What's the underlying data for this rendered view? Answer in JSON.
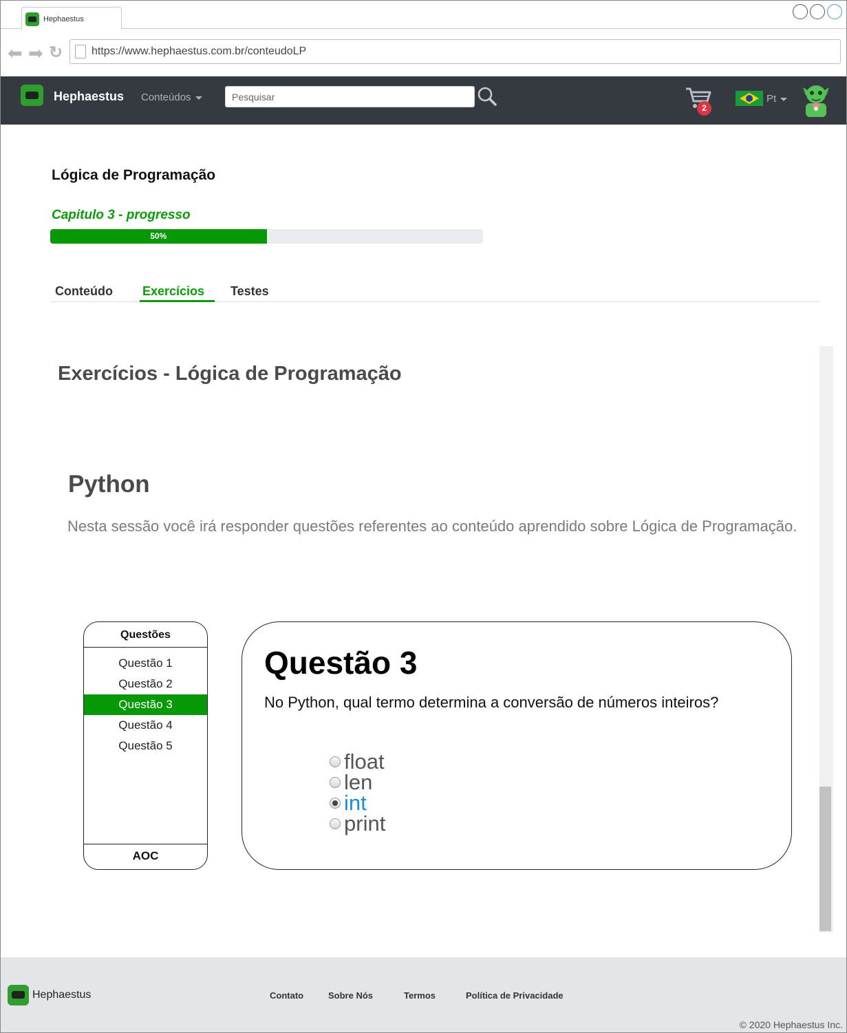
{
  "browser": {
    "tab_title": "Hephaestus",
    "url": "https://www.hephaestus.com.br/conteudoLP"
  },
  "navbar": {
    "brand": "Hephaestus",
    "menu_label": "Conteúdos",
    "search_placeholder": "Pesquisar",
    "cart_count": "2",
    "language": "Pt"
  },
  "course": {
    "title": "Lógica de Programação",
    "chapter_label": "Capitulo 3 - progresso",
    "progress_text": "50%",
    "progress_value": 0.5
  },
  "tabs": [
    {
      "label": "Conteúdo"
    },
    {
      "label": "Exercícios",
      "active": true
    },
    {
      "label": "Testes"
    }
  ],
  "exercises": {
    "heading": "Exercícios -  Lógica de Programação",
    "section_title": "Python",
    "intro": "Nesta sessão você irá responder questões referentes ao conteúdo aprendido sobre Lógica de Programação."
  },
  "question_list": {
    "header": "Questões",
    "items": [
      "Questão 1",
      "Questão 2",
      "Questão 3",
      "Questão 4",
      "Questão 5"
    ],
    "active_index": 2,
    "footer": "AOC"
  },
  "question": {
    "title": "Questão 3",
    "text": "No Python, qual termo determina a conversão de números inteiros?",
    "options": [
      "float",
      "len",
      "int",
      "print"
    ],
    "selected_index": 2
  },
  "footer": {
    "brand": "Hephaestus",
    "links": [
      "Contato",
      "Sobre Nós",
      "Termos",
      "Política de Privacidade"
    ],
    "copyright": "© 2020 Hephaestus Inc."
  },
  "colors": {
    "accent_green": "#0a9a0a",
    "navbar_bg": "#343a40",
    "selected_option": "#1a8ae0",
    "badge_red": "#dc3545"
  }
}
